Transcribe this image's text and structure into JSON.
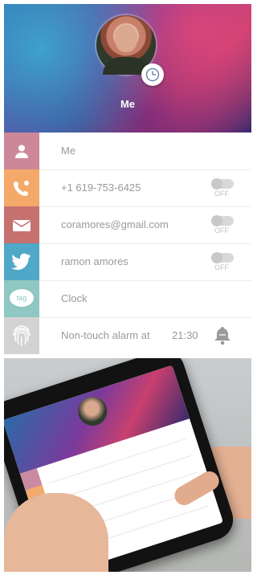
{
  "header": {
    "profile_name": "Me"
  },
  "contact_list": {
    "rows": [
      {
        "label": "Me",
        "icon": "person-icon",
        "color": "#cc8899",
        "has_toggle": false
      },
      {
        "label": "+1 619-753-6425",
        "icon": "phone-icon",
        "color": "#f4a96a",
        "has_toggle": true,
        "toggle_state": "OFF"
      },
      {
        "label": "coramores@gmail.com",
        "icon": "mail-icon",
        "color": "#c67070",
        "has_toggle": true,
        "toggle_state": "OFF"
      },
      {
        "label": "ramon amores",
        "icon": "twitter-bird-icon",
        "color": "#4fa8c8",
        "has_toggle": true,
        "toggle_state": "OFF"
      },
      {
        "label": "Clock",
        "icon": "tag-icon",
        "tag_text": "tag",
        "color": "#8fc7c2",
        "has_toggle": false
      },
      {
        "label": "Non-touch alarm at",
        "icon": "fingerprint-icon",
        "color": "#d3d3d3",
        "time": "21:30",
        "has_bell": true
      }
    ]
  },
  "colors": {
    "accent_pink": "#cc8899",
    "accent_orange": "#f4a96a",
    "accent_red": "#c67070",
    "accent_blue": "#4fa8c8",
    "accent_teal": "#8fc7c2"
  }
}
